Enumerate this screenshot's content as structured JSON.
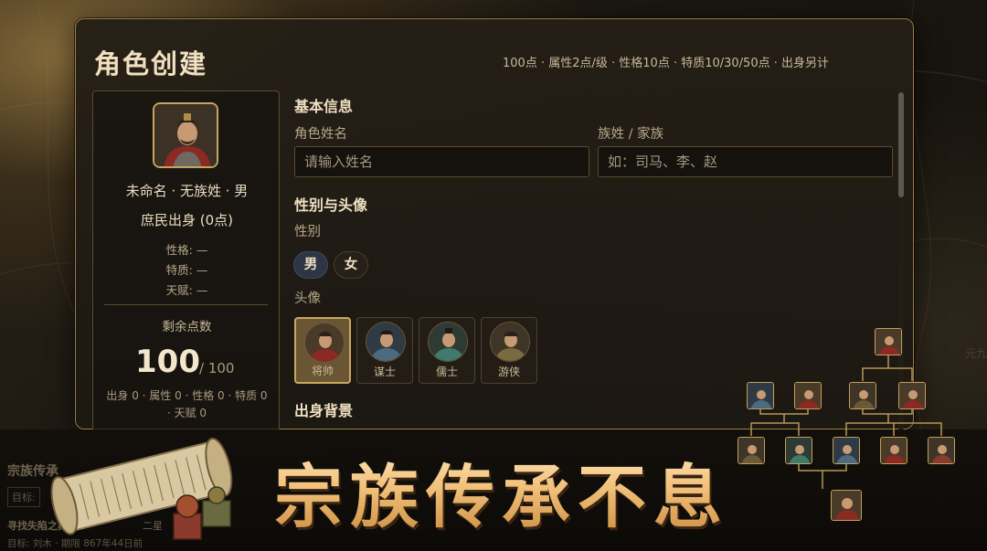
{
  "panel": {
    "title": "角色创建",
    "rules": "100点 · 属性2点/级 · 性格10点 · 特质10/30/50点 · 出身另计"
  },
  "character_card": {
    "summary": "未命名 · 无族姓 · 男",
    "origin": "庶民出身 (0点)",
    "stats": [
      "性格: —",
      "特质: —",
      "天赋: —"
    ],
    "points_label": "剩余点数",
    "points_remaining": "100",
    "points_total": "/ 100",
    "points_breakdown": "出身 0 · 属性 0 · 性格 0 · 特质 0 · 天赋 0"
  },
  "form": {
    "basic_info_heading": "基本信息",
    "name_label": "角色姓名",
    "name_placeholder": "请输入姓名",
    "clan_label": "族姓 / 家族",
    "clan_placeholder": "如：司马、李、赵",
    "gender_avatar_heading": "性别与头像",
    "gender_label": "性别",
    "gender_options": [
      "男",
      "女"
    ],
    "gender_selected": "男",
    "avatar_label": "头像",
    "avatars": [
      "将帅",
      "谋士",
      "儒士",
      "游侠"
    ],
    "avatar_selected": "将帅",
    "origin_heading": "出身背景"
  },
  "background_ui": {
    "title": "宗族传承",
    "target": "目标:",
    "quest": "寻找失陷之舞阴",
    "rank": "二星",
    "status": "目标: 刘木 · 期限 867年44日前",
    "right_edge_text": "元九"
  },
  "promo": {
    "slogan": "宗族传承不息"
  },
  "colors": {
    "gold_border": "#c2a05c",
    "panel_bg": "#241e16",
    "selected_gender": "#2e3646",
    "selected_avatar": "#6a5632"
  }
}
